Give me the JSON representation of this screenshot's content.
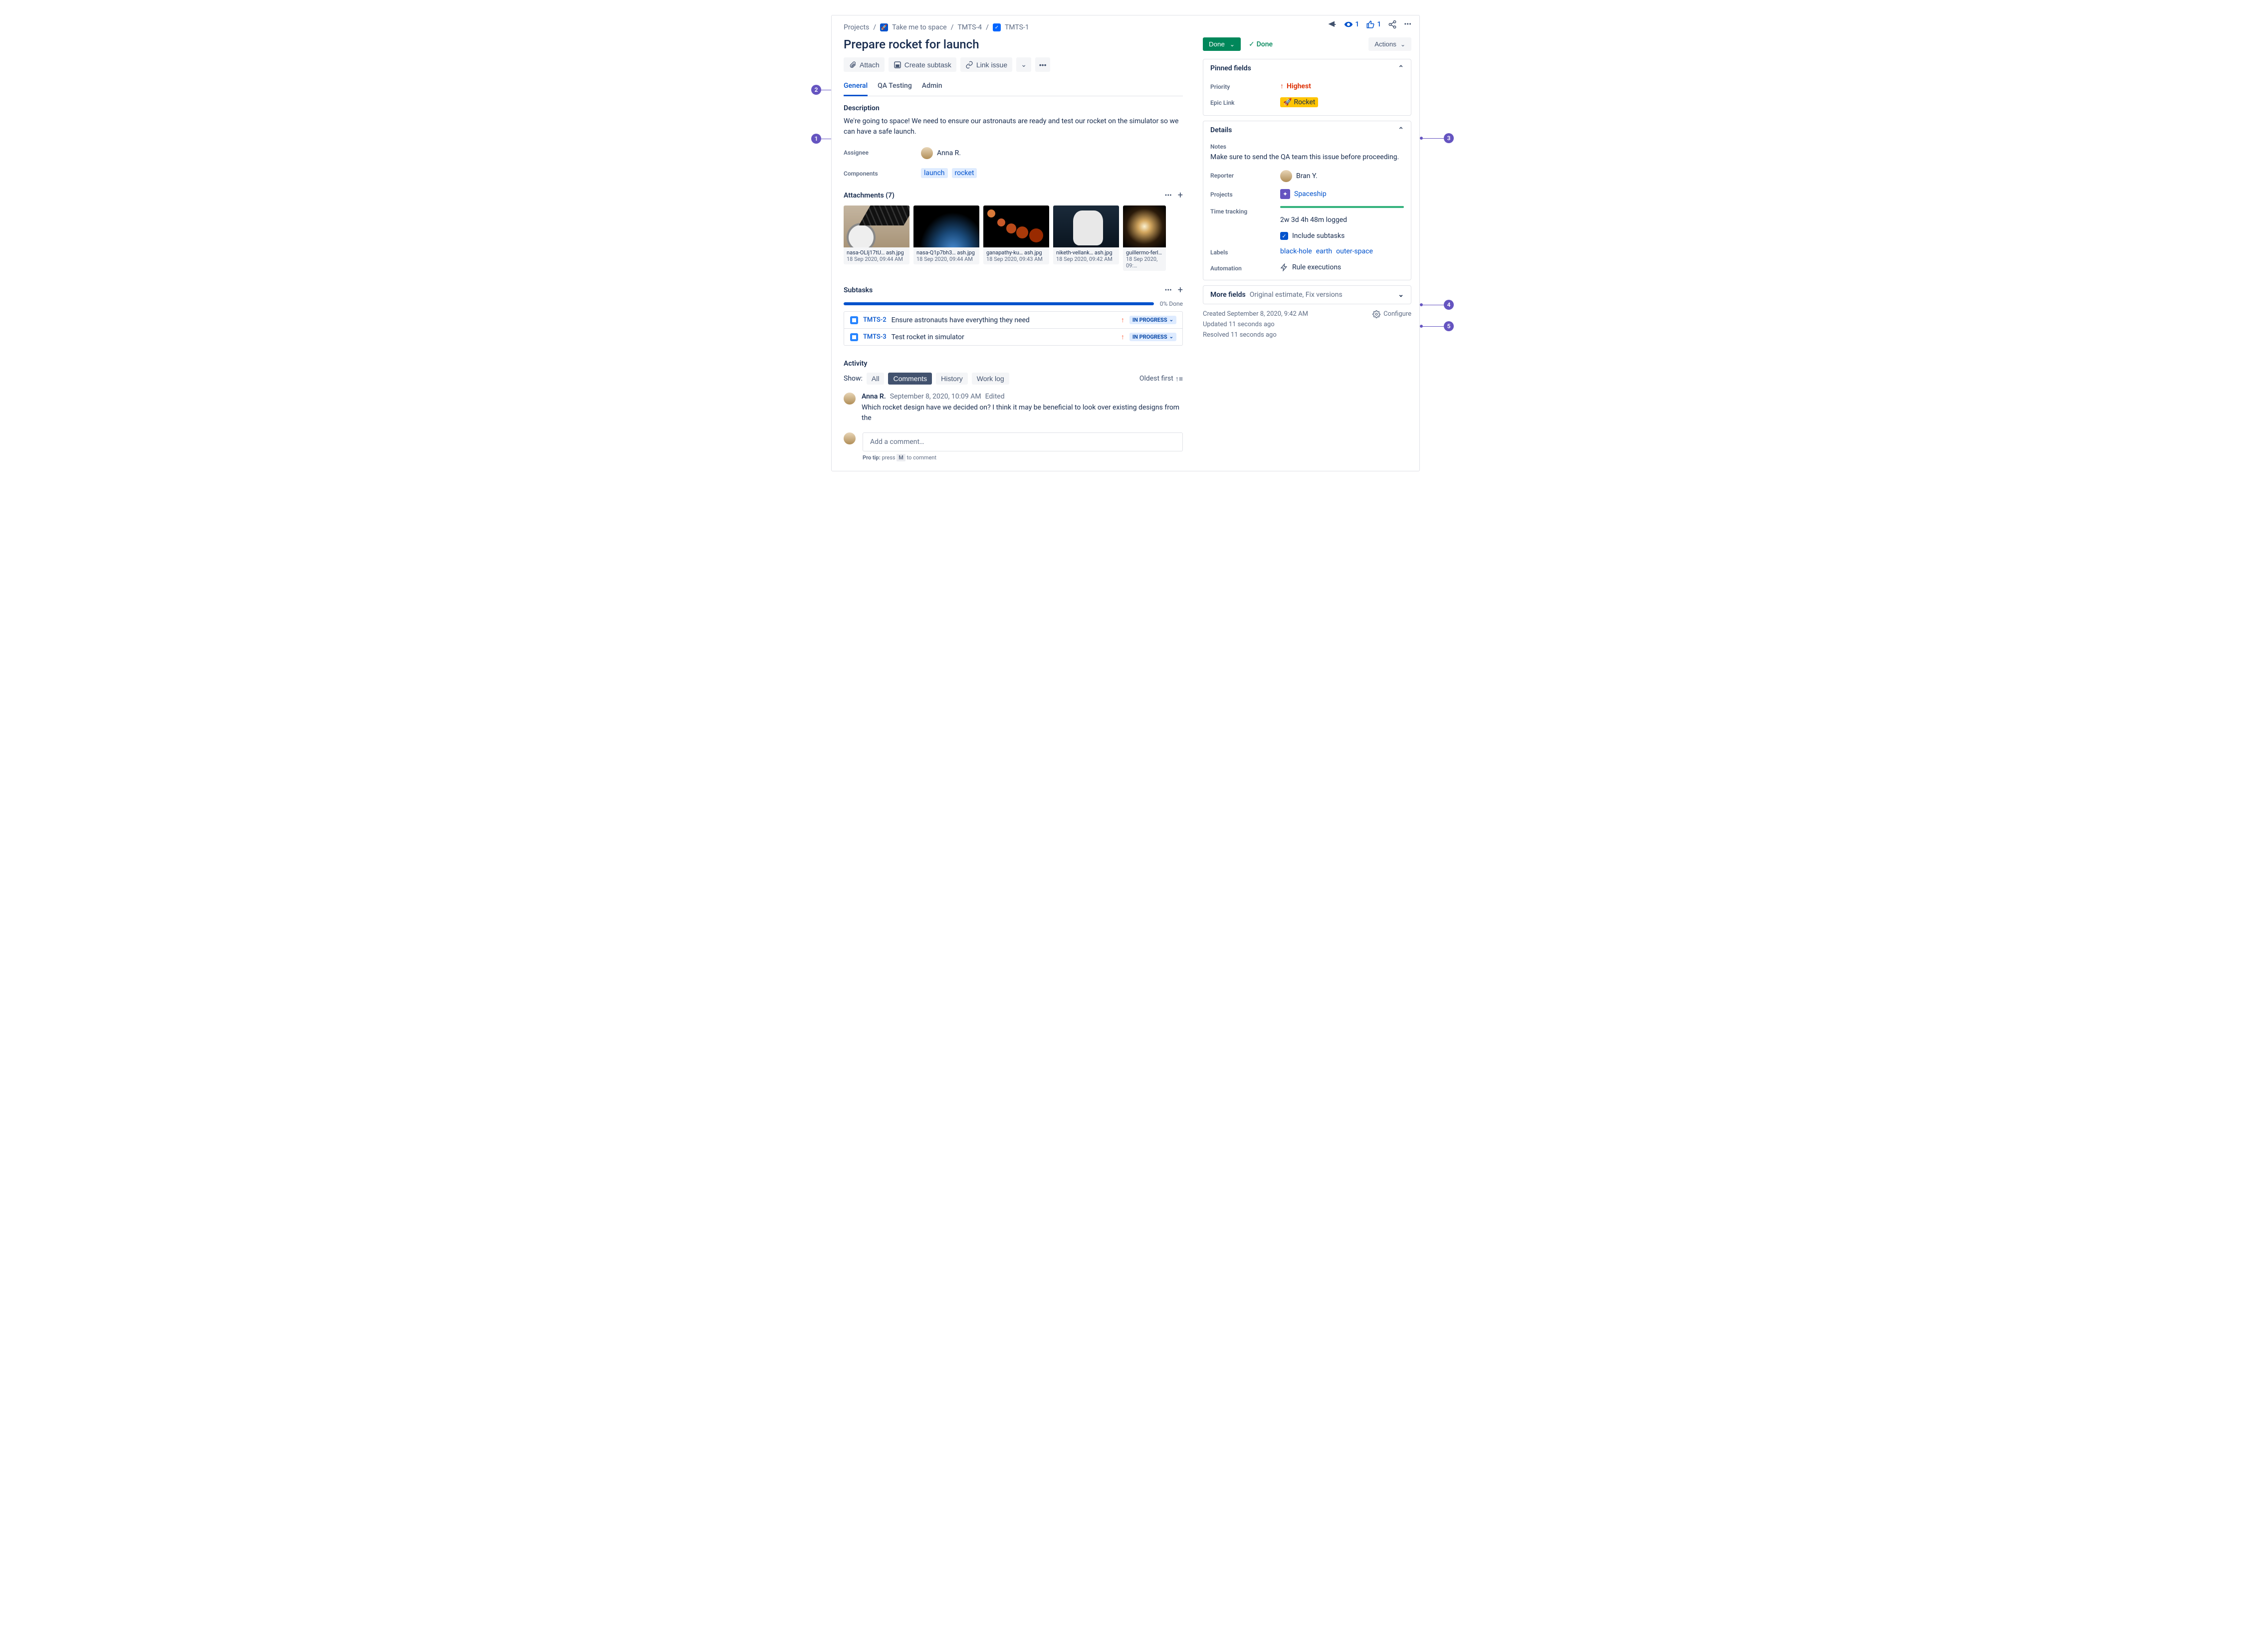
{
  "breadcrumbs": {
    "projects": "Projects",
    "project_name": "Take me to space",
    "parent_key": "TMTS-4",
    "issue_key": "TMTS-1"
  },
  "title": "Prepare rocket for launch",
  "toolbar": {
    "attach": "Attach",
    "create_subtask": "Create subtask",
    "link_issue": "Link issue"
  },
  "tabs": {
    "general": "General",
    "qa_testing": "QA Testing",
    "admin": "Admin"
  },
  "description": {
    "label": "Description",
    "text": "We're going to space! We need to ensure our astronauts are ready and test our rocket on the simulator so we can have a safe launch."
  },
  "assignee": {
    "label": "Assignee",
    "name": "Anna R."
  },
  "components": {
    "label": "Components",
    "items": [
      "launch",
      "rocket"
    ]
  },
  "attachments": {
    "header": "Attachments (7)",
    "items": [
      {
        "name": "nasa-OLIj17tU… ash.jpg",
        "date": "18 Sep 2020, 09:44 AM"
      },
      {
        "name": "nasa-Q1p7bh3… ash.jpg",
        "date": "18 Sep 2020, 09:44 AM"
      },
      {
        "name": "ganapathy-ku… ash.jpg",
        "date": "18 Sep 2020, 09:43 AM"
      },
      {
        "name": "niketh-vellank… ash.jpg",
        "date": "18 Sep 2020, 09:42 AM"
      },
      {
        "name": "guillermo-ferl…  a…",
        "date": "18 Sep 2020, 09:…"
      }
    ]
  },
  "subtasks": {
    "header": "Subtasks",
    "progress": "0% Done",
    "items": [
      {
        "key": "TMTS-2",
        "title": "Ensure astronauts have everything they need",
        "status": "IN PROGRESS"
      },
      {
        "key": "TMTS-3",
        "title": "Test rocket in simulator",
        "status": "IN PROGRESS"
      }
    ]
  },
  "activity": {
    "header": "Activity",
    "show_label": "Show:",
    "all": "All",
    "comments": "Comments",
    "history": "History",
    "work_log": "Work log",
    "oldest_first": "Oldest first",
    "comment": {
      "author": "Anna R.",
      "date": "September 8, 2020, 10:09 AM",
      "edited": "Edited",
      "text": "Which rocket design have we decided on? I think it may be beneficial to look over existing designs from the"
    },
    "add_placeholder": "Add a comment…",
    "pro_tip_pre": "Pro tip: ",
    "pro_tip_press": "press ",
    "pro_tip_key": "M",
    "pro_tip_post": " to comment"
  },
  "header_actions": {
    "watchers": "1",
    "votes": "1"
  },
  "status": {
    "done": "Done",
    "resolution": "Done",
    "actions": "Actions"
  },
  "pinned": {
    "title": "Pinned fields",
    "priority_label": "Priority",
    "priority_value": "Highest",
    "epic_label": "Epic Link",
    "epic_value": "Rocket"
  },
  "details": {
    "title": "Details",
    "notes_label": "Notes",
    "notes_text": "Make sure to send the QA team this issue before proceeding.",
    "reporter_label": "Reporter",
    "reporter_name": "Bran Y.",
    "projects_label": "Projects",
    "projects_value": "Spaceship",
    "time_label": "Time tracking",
    "time_value": "2w 3d 4h 48m logged",
    "include_subtasks": "Include subtasks",
    "labels_label": "Labels",
    "labels_items": [
      "black-hole",
      "earth",
      "outer-space"
    ],
    "automation_label": "Automation",
    "automation_value": "Rule executions"
  },
  "more_fields": {
    "title": "More fields",
    "hint": "Original estimate, Fix versions"
  },
  "meta": {
    "created": "Created September 8, 2020, 9:42 AM",
    "updated": "Updated 11 seconds ago",
    "resolved": "Resolved 11 seconds ago",
    "configure": "Configure"
  },
  "callouts": {
    "1": "1",
    "2": "2",
    "3": "3",
    "4": "4",
    "5": "5"
  }
}
